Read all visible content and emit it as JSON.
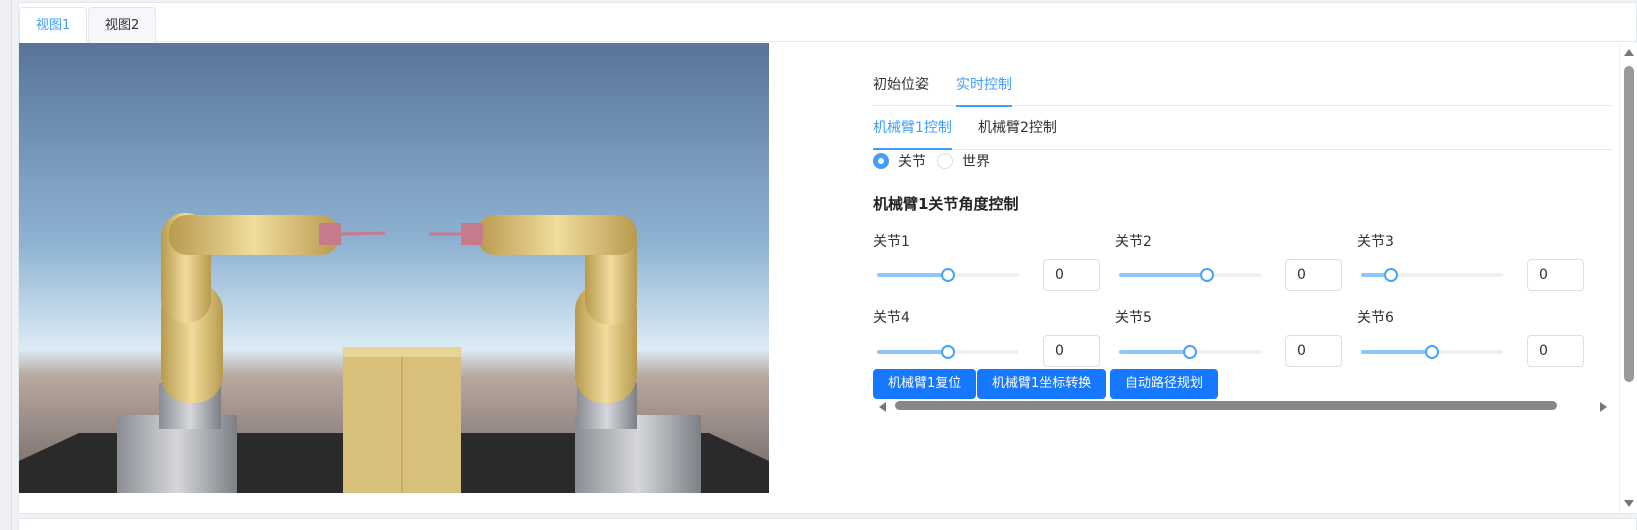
{
  "top_tabs": [
    "视图1",
    "视图2"
  ],
  "panel": {
    "mode_tabs": [
      "初始位姿",
      "实时控制"
    ],
    "arm_tabs": [
      "机械臂1控制",
      "机械臂2控制"
    ],
    "radio": [
      "关节",
      "世界"
    ],
    "selected_radio": "关节",
    "section_title": "机械臂1关节角度控制",
    "joints": [
      {
        "label": "关节1",
        "value": "0",
        "slider_level": 0.5
      },
      {
        "label": "关节2",
        "value": "0",
        "slider_level": 0.62
      },
      {
        "label": "关节3",
        "value": "0",
        "slider_level": 0.21
      },
      {
        "label": "关节4",
        "value": "0",
        "slider_level": 0.5
      },
      {
        "label": "关节5",
        "value": "0",
        "slider_level": 0.5
      },
      {
        "label": "关节6",
        "value": "0",
        "slider_level": 0.5
      }
    ],
    "buttons": [
      "机械臂1复位",
      "机械臂1坐标转换",
      "自动路径规划"
    ]
  },
  "colors": {
    "accent": "#409eff",
    "button": "#1677ff",
    "slider_fill": "#8ec5fc",
    "sky_top": "#587599",
    "sky_horizon": "#dcecf5",
    "robot_gold": "#d9c07a"
  },
  "scene": {
    "content": "two-gold-robot-arms-and-box"
  }
}
